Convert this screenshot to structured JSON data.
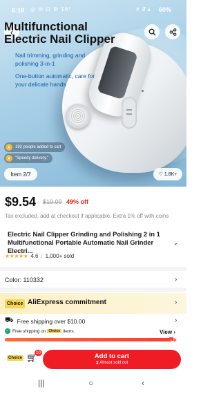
{
  "status_bar": {
    "time": "6:18",
    "left_icons": "◎ ✉ ⊡ ⚙ 16°",
    "right_icons": "✕ ⇵ ▴",
    "battery": "60%"
  },
  "hero": {
    "title": "Multifunctional Electric Nail Clipper",
    "tagline_1": "Nail trimming, grinding and polishing 3-in-1",
    "tagline_2": "One-button automatic, care for your delicate hands",
    "added_to_cart": "192 people added to cart",
    "speedy_delivery": "\"Speedy delivery.\"",
    "item_counter": "Item 2/7",
    "likes": "1.8K+"
  },
  "price": {
    "current": "$9.54",
    "original": "$19.09",
    "discount": "49% off",
    "tax_note": "Tax excluded, add at checkout if applicable. Extra 1% off with coins"
  },
  "product": {
    "title": "Electric Nail Clipper Grinding and Polishing 2 in 1 Multifunctional Portable Automatic Nail Grinder Electri...",
    "rating": "4.6",
    "sold": "1,000+ sold"
  },
  "variant": {
    "color_label": "Color: 110332"
  },
  "commitment": {
    "choice_tag": "Choice",
    "title": "AliExpress commitment",
    "free_shipping": "Free shipping over $10.00",
    "choice_note_prefix": "Free shipping on",
    "choice_note_tag": "Choice",
    "choice_note_suffix": "items.",
    "view_label": "View",
    "progress": 0.954
  },
  "bottom_bar": {
    "choice_label": "Choice",
    "cart_count": "10",
    "add_to_cart": "Add to cart",
    "almost_sold_out": "Almost sold out"
  },
  "colors": {
    "accent_red": "#f01c24",
    "choice_yellow": "#f7d652",
    "discount_red": "#e0261b"
  }
}
